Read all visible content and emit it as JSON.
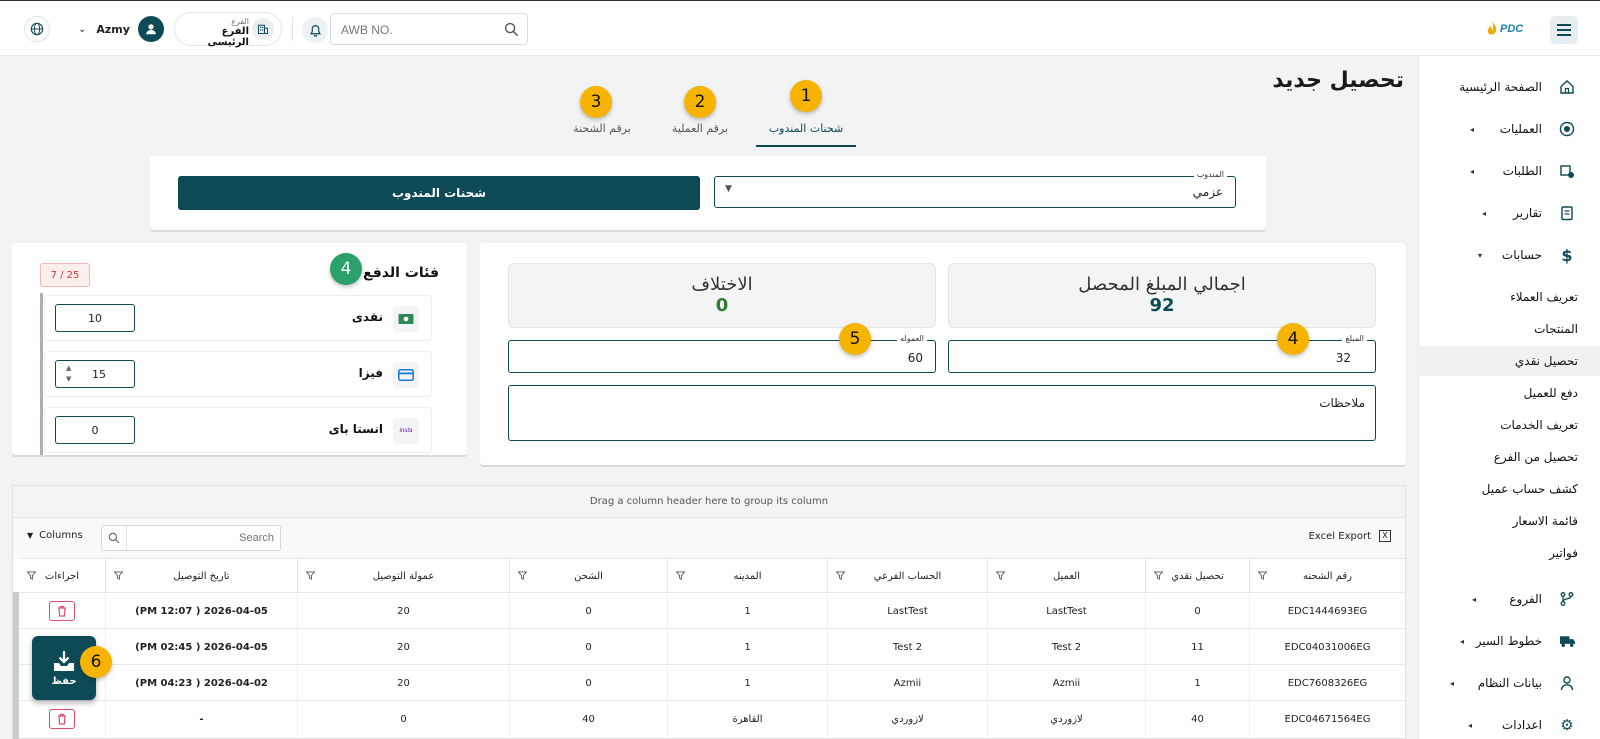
{
  "header": {
    "logo_text": "PDC",
    "user_name": "Azmy",
    "branch_caption": "الفرع",
    "branch_name": "الفرع الرئيسى",
    "search_placeholder": "AWB NO."
  },
  "page": {
    "title": "تحصيل جديد"
  },
  "tabs": [
    {
      "label": "شحنات المندوب",
      "badge": "1",
      "active": true
    },
    {
      "label": "برقم العملية",
      "badge": "2",
      "active": false
    },
    {
      "label": "برقم الشحنة",
      "badge": "3",
      "active": false
    }
  ],
  "agent_form": {
    "field_label": "المندوب",
    "field_value": "عزمي",
    "button_label": "شحنات المندوب"
  },
  "summary": {
    "total_label": "اجمالي المبلغ المحصل",
    "total_value": "92",
    "diff_label": "الاختلاف",
    "diff_value": "0",
    "amount_label": "المبلغ",
    "amount_value": "32",
    "amount_badge": "4",
    "commission_label": "العموله",
    "commission_value": "60",
    "commission_badge": "5",
    "notes_label": "ملاحظات"
  },
  "payment": {
    "title": "فئات الدفع",
    "badge": "4",
    "count": "7 / 25",
    "rows": [
      {
        "label": "نقدى",
        "value": "10",
        "icon": "cash-icon"
      },
      {
        "label": "فيزا",
        "value": "15",
        "icon": "card-icon"
      },
      {
        "label": "انستا باى",
        "value": "0",
        "icon": "instapay-icon"
      }
    ]
  },
  "grid": {
    "group_hint": "Drag a column header here to group its column",
    "columns_label": "Columns",
    "search_placeholder": "Search",
    "excel_label": "Excel Export",
    "headers": [
      "رقم الشحنه",
      "تحصيل نقدي",
      "العميل",
      "الحساب الفرعي",
      "المدينه",
      "الشحن",
      "عمولة التوصيل",
      "تاريخ التوصيل",
      "اجراءات"
    ],
    "rows": [
      [
        "EDC1444693EG",
        "0",
        "LastTest",
        "LastTest",
        "1",
        "0",
        "20",
        "2026-04-05 ( 12:07 PM)"
      ],
      [
        "EDC04031006EG",
        "11",
        "Test 2",
        "Test 2",
        "1",
        "0",
        "20",
        "2026-04-05 ( 02:45 PM)"
      ],
      [
        "EDC7608326EG",
        "1",
        "Azmii",
        "Azmii",
        "1",
        "0",
        "20",
        "2026-04-02 ( 04:23 PM)"
      ],
      [
        "EDC04671564EG",
        "40",
        "لازوردي",
        "لازوردي",
        "القاهرة",
        "40",
        "0",
        "-"
      ]
    ]
  },
  "save": {
    "label": "حفظ",
    "badge": "6"
  },
  "sidebar": {
    "items": [
      {
        "label": "الصفحة الرئيسية",
        "icon": "home-icon"
      },
      {
        "label": "العمليات",
        "icon": "operations-icon"
      },
      {
        "label": "الطلبات",
        "icon": "orders-icon"
      },
      {
        "label": "تقارير",
        "icon": "reports-icon"
      },
      {
        "label": "حسابات",
        "icon": "dollar-icon"
      }
    ],
    "sub_items": [
      "تعريف العملاء",
      "المنتجات",
      "تحصيل نقدي",
      "دفع للعميل",
      "تعريف الخدمات",
      "تحصيل من الفرع",
      "كشف حساب عميل",
      "قائمة الاسعار",
      "فواتير"
    ],
    "lower_items": [
      {
        "label": "الفروع",
        "icon": "branch-icon"
      },
      {
        "label": "خطوط السير",
        "icon": "truck-icon"
      },
      {
        "label": "بيانات النظام",
        "icon": "user-icon"
      },
      {
        "label": "اعدادات",
        "icon": "settings-icon"
      }
    ]
  },
  "colors": {
    "primary": "#0e4a56",
    "accent_badge": "#f6b400",
    "positive": "#2e7d32",
    "danger": "#e24b6a"
  }
}
